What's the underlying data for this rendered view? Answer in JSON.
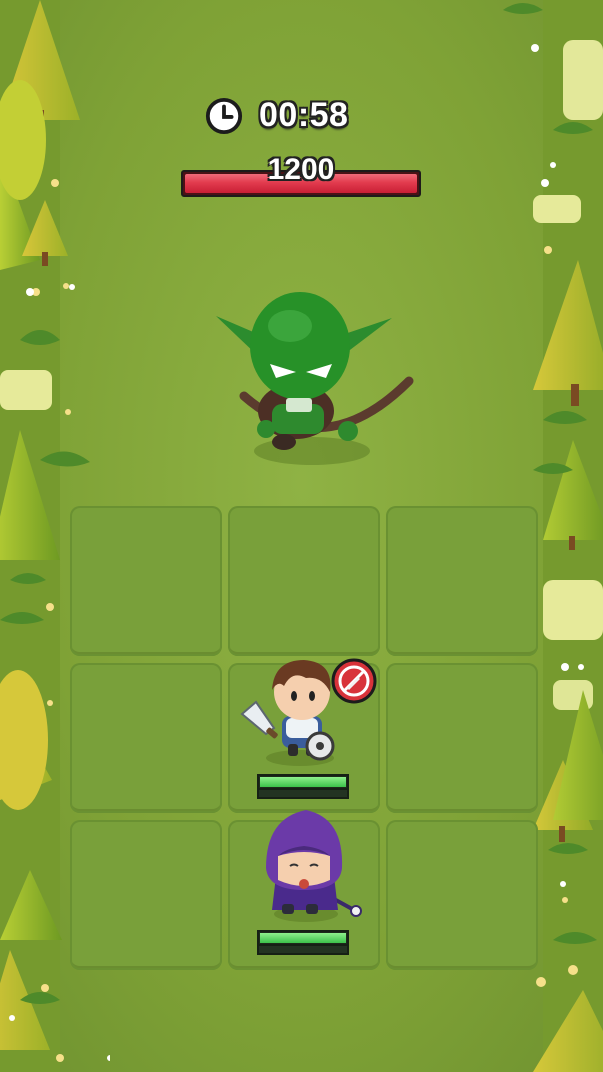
{
  "hud": {
    "timer_icon": "clock-icon",
    "timer_text": "00:58",
    "boss_hp_text": "1200",
    "boss_hp_fraction": 1.0
  },
  "enemy": {
    "name_icon": "goblin-archer"
  },
  "heroes": [
    {
      "icon": "knight-hero",
      "hp_fraction": 1.0,
      "status_icon": "no-attack-icon"
    },
    {
      "icon": "wizard-hero",
      "hp_fraction": 1.0
    }
  ],
  "board": {
    "rows": 3,
    "cols": 3
  },
  "colors": {
    "grass": "#86a83a",
    "tile": "#79a03a",
    "boss_hp": "#e23b4e",
    "hero_hp": "#4fcf5a"
  }
}
